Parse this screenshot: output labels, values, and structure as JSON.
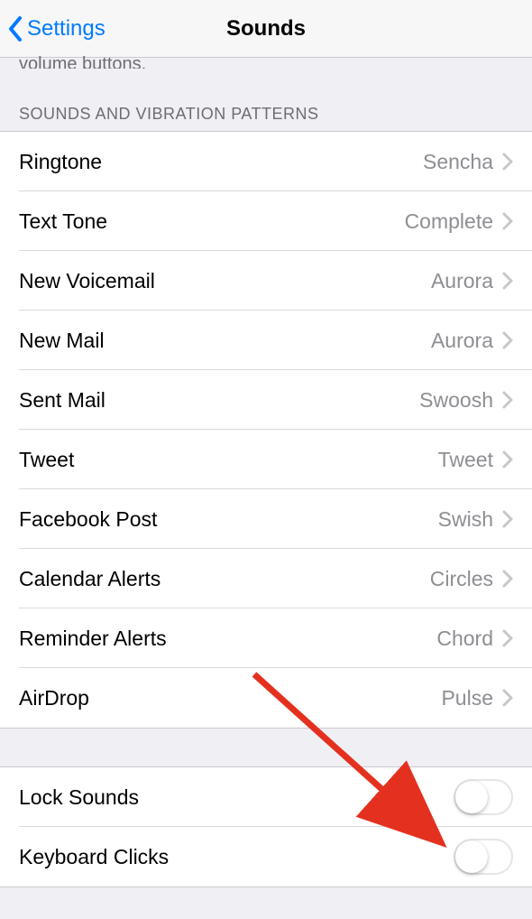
{
  "nav": {
    "back_label": "Settings",
    "title": "Sounds"
  },
  "truncated": "volume buttons.",
  "section_header": "SOUNDS AND VIBRATION PATTERNS",
  "sounds": [
    {
      "label": "Ringtone",
      "value": "Sencha"
    },
    {
      "label": "Text Tone",
      "value": "Complete"
    },
    {
      "label": "New Voicemail",
      "value": "Aurora"
    },
    {
      "label": "New Mail",
      "value": "Aurora"
    },
    {
      "label": "Sent Mail",
      "value": "Swoosh"
    },
    {
      "label": "Tweet",
      "value": "Tweet"
    },
    {
      "label": "Facebook Post",
      "value": "Swish"
    },
    {
      "label": "Calendar Alerts",
      "value": "Circles"
    },
    {
      "label": "Reminder Alerts",
      "value": "Chord"
    },
    {
      "label": "AirDrop",
      "value": "Pulse"
    }
  ],
  "toggles": [
    {
      "label": "Lock Sounds",
      "on": false
    },
    {
      "label": "Keyboard Clicks",
      "on": false
    }
  ]
}
